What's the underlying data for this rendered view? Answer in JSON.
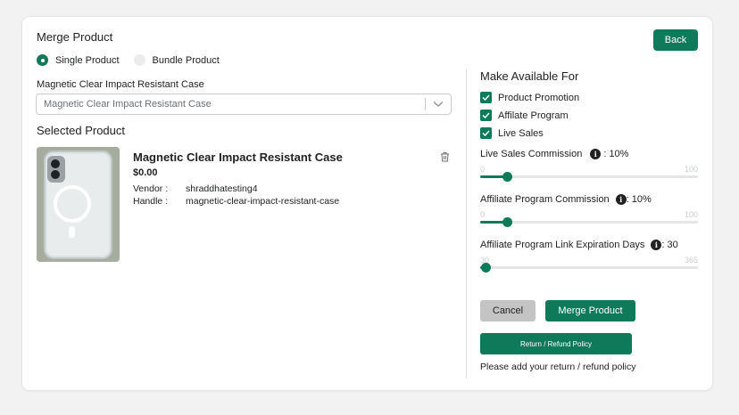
{
  "page": {
    "title": "Merge Product",
    "back_label": "Back"
  },
  "mode": {
    "options": [
      "Single Product",
      "Bundle Product"
    ],
    "selected": "Single Product"
  },
  "product_select": {
    "label": "Magnetic Clear Impact Resistant Case",
    "value": "Magnetic Clear Impact Resistant Case"
  },
  "selected": {
    "heading": "Selected Product",
    "name": "Magnetic Clear Impact Resistant Case",
    "price": "$0.00",
    "vendor_label": "Vendor :",
    "vendor": "shraddhatesting4",
    "handle_label": "Handle :",
    "handle": "magnetic-clear-impact-resistant-case"
  },
  "availability": {
    "heading": "Make Available For",
    "options": [
      {
        "label": "Product Promotion",
        "checked": true
      },
      {
        "label": "Affilate Program",
        "checked": true
      },
      {
        "label": "Live Sales",
        "checked": true
      }
    ]
  },
  "sliders": [
    {
      "label": "Live Sales Commission",
      "value_text": ": 10%",
      "min": 0,
      "max": 100,
      "value": 10,
      "min_label": "0",
      "max_label": "100"
    },
    {
      "label": "Affiliate Program Commission",
      "value_text": ": 10%",
      "min": 0,
      "max": 100,
      "value": 10,
      "min_label": "0",
      "max_label": "100"
    },
    {
      "label": "Affiliate Program Link Expiration Days",
      "value_text": ": 30",
      "min": 30,
      "max": 365,
      "value": 30,
      "min_label": "30",
      "max_label": "365"
    }
  ],
  "actions": {
    "cancel": "Cancel",
    "merge": "Merge Product",
    "policy": "Return / Refund Policy",
    "policy_note": "Please add your return / refund policy"
  },
  "colors": {
    "accent": "#0f7a5a",
    "cancel_bg": "#c4c4c4"
  }
}
